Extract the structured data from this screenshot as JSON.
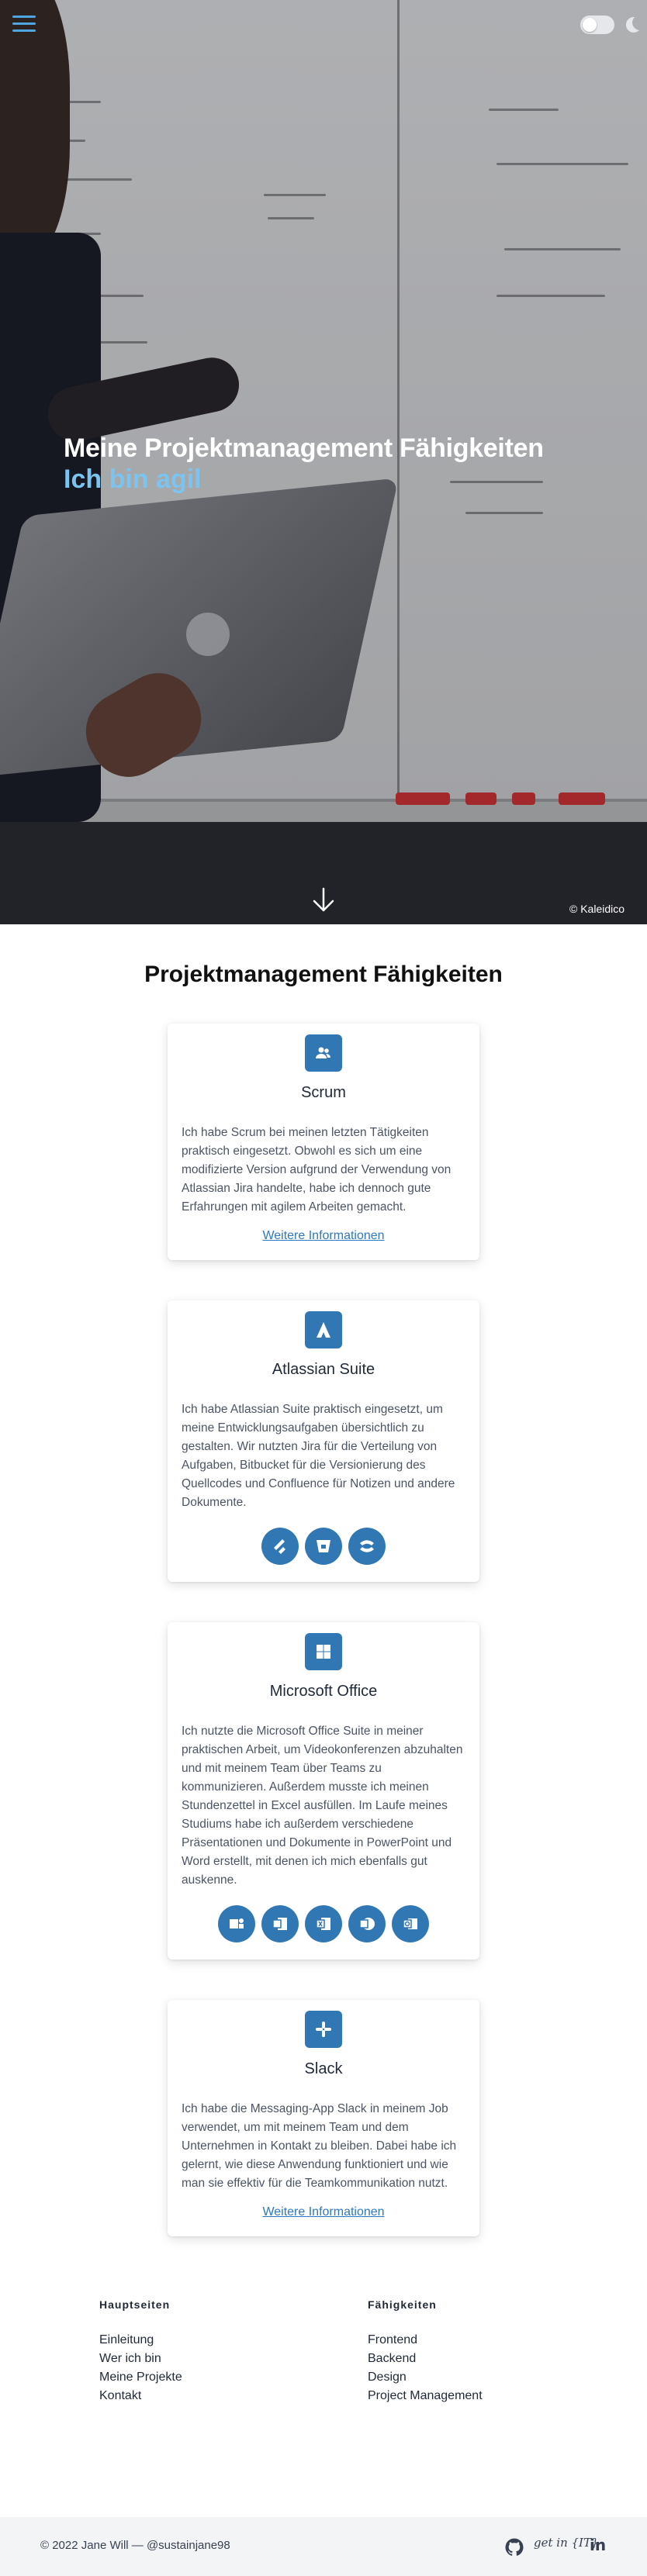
{
  "hero": {
    "title": "Meine Projektmanagement Fähigkeiten",
    "subtitle": "Ich bin agil",
    "credit": "© Kaleidico"
  },
  "header": {
    "menu_icon": "hamburger-menu-icon",
    "theme_toggle_icon": "moon-icon"
  },
  "main": {
    "section_title": "Projektmanagement Fähigkeiten",
    "cards": [
      {
        "icon": "people-icon",
        "title": "Scrum",
        "text": "Ich habe Scrum bei meinen letzten Tätigkeiten praktisch eingesetzt. Obwohl es sich um eine modifizierte Version aufgrund der Verwendung von Atlassian Jira handelte, habe ich dennoch gute Erfahrungen mit agilem Arbeiten gemacht.",
        "link": "Weitere Informationen"
      },
      {
        "icon": "atlassian-icon",
        "title": "Atlassian Suite",
        "text": "Ich habe Atlassian Suite praktisch eingesetzt, um meine Entwicklungsaufgaben übersichtlich zu gestalten. Wir nutzten Jira für die Verteilung von Aufgaben, Bitbucket für die Versionierung des Quellcodes und Confluence für Notizen und andere Dokumente.",
        "badges": [
          "jira-icon",
          "bitbucket-icon",
          "confluence-icon"
        ]
      },
      {
        "icon": "windows-icon",
        "title": "Microsoft Office",
        "text": "Ich nutzte die Microsoft Office Suite in meiner praktischen Arbeit, um Videokonferenzen abzuhalten und mit meinem Team über Teams zu kommunizieren. Außerdem musste ich meinen Stundenzettel in Excel ausfüllen. Im Laufe meines Studiums habe ich außerdem verschiedene Präsentationen und Dokumente in PowerPoint und Word erstellt, mit denen ich mich ebenfalls gut auskenne.",
        "badges": [
          "teams-icon",
          "word-icon",
          "excel-icon",
          "powerpoint-icon",
          "outlook-icon"
        ]
      },
      {
        "icon": "slack-icon",
        "title": "Slack",
        "text": "Ich habe die Messaging-App Slack in meinem Job verwendet, um mit meinem Team und dem Unternehmen in Kontakt zu bleiben. Dabei habe ich gelernt, wie diese Anwendung funktioniert und wie man sie effektiv für die Teamkommunikation nutzt.",
        "link": "Weitere Informationen"
      }
    ]
  },
  "footer": {
    "col1": {
      "heading": "Hauptseiten",
      "links": [
        "Einleitung",
        "Wer ich bin",
        "Meine Projekte",
        "Kontakt"
      ]
    },
    "col2": {
      "heading": "Fähigkeiten",
      "links": [
        "Frontend",
        "Backend",
        "Design",
        "Project Management"
      ]
    },
    "copyright": "© 2022 Jane Will — @sustainjane98",
    "social_icons": [
      "github-icon",
      "get-in-it-icon",
      "linkedin-icon"
    ],
    "get_in_it_label": "get in {IT}",
    "linkedin_label": "in"
  },
  "colors": {
    "accent": "#3177b4",
    "subtitle": "#7cc4f0",
    "link": "#2b79c2"
  }
}
